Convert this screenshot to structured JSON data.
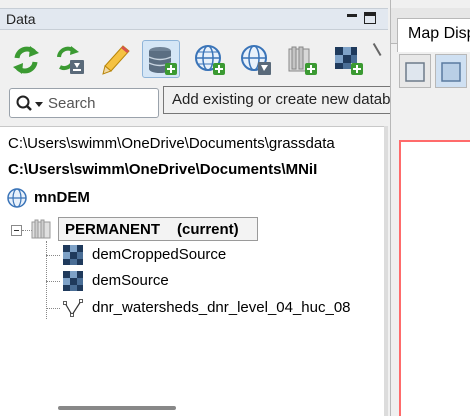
{
  "data_panel": {
    "title": "Data",
    "toolbar": [
      {
        "name": "reload-button",
        "icon": "reload-icon"
      },
      {
        "name": "download-sample-button",
        "icon": "download-sample-icon"
      },
      {
        "name": "edit-button",
        "icon": "pencil-icon"
      },
      {
        "name": "add-database-button",
        "icon": "database-add-icon",
        "active": true
      },
      {
        "name": "add-location-button",
        "icon": "globe-add-icon"
      },
      {
        "name": "import-location-button",
        "icon": "globe-import-icon"
      },
      {
        "name": "add-mapset-button",
        "icon": "mapset-add-icon"
      },
      {
        "name": "import-raster-button",
        "icon": "raster-import-icon"
      }
    ],
    "search": {
      "placeholder": "Search"
    },
    "tooltip": "Add existing or create new database",
    "tree": {
      "paths": [
        "C:\\Users\\swimm\\OneDrive\\Documents\\grassdata",
        "C:\\Users\\swimm\\OneDrive\\Documents\\MNiI"
      ],
      "location": "mnDEM",
      "mapset": "PERMANENT",
      "mapset_status": "(current)",
      "layers": [
        {
          "label": "demCroppedSource",
          "type": "raster"
        },
        {
          "label": "demSource",
          "type": "raster"
        },
        {
          "label": "dnr_watersheds_dnr_level_04_huc_08",
          "type": "vector"
        }
      ]
    }
  },
  "map_panel": {
    "tab_label": "Map Display"
  },
  "colors": {
    "accent": "#d5e6f6",
    "canvas_border": "#ff6b6b",
    "header": "#e2e8f0"
  }
}
